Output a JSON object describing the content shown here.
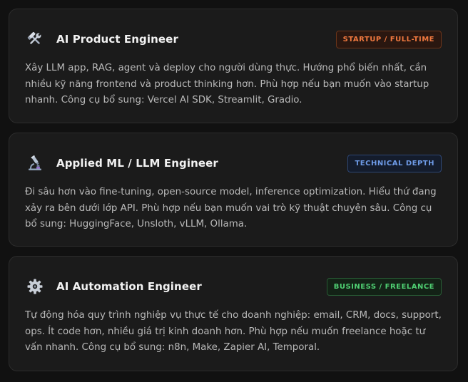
{
  "cards": [
    {
      "icon": "tools-icon",
      "title": "AI Product Engineer",
      "badge": "STARTUP / FULL-TIME",
      "badge_color": "#f0793f",
      "description": "Xây LLM app, RAG, agent và deploy cho người dùng thực. Hướng phổ biến nhất, cần nhiều kỹ năng frontend và product thinking hơn. Phù hợp nếu bạn muốn vào startup nhanh. Công cụ bổ sung: Vercel AI SDK, Streamlit, Gradio."
    },
    {
      "icon": "microscope-icon",
      "title": "Applied ML / LLM Engineer",
      "badge": "TECHNICAL DEPTH",
      "badge_color": "#6f9ce8",
      "description": "Đi sâu hơn vào fine-tuning, open-source model, inference optimization. Hiểu thứ đang xảy ra bên dưới lớp API. Phù hợp nếu bạn muốn vai trò kỹ thuật chuyên sâu. Công cụ bổ sung: HuggingFace, Unsloth, vLLM, Ollama."
    },
    {
      "icon": "gear-icon",
      "title": "AI Automation Engineer",
      "badge": "BUSINESS / FREELANCE",
      "badge_color": "#4fcf72",
      "description": "Tự động hóa quy trình nghiệp vụ thực tế cho doanh nghiệp: email, CRM, docs, support, ops. Ít code hơn, nhiều giá trị kinh doanh hơn. Phù hợp nếu muốn freelance hoặc tư vấn nhanh. Công cụ bổ sung: n8n, Make, Zapier AI, Temporal."
    }
  ]
}
